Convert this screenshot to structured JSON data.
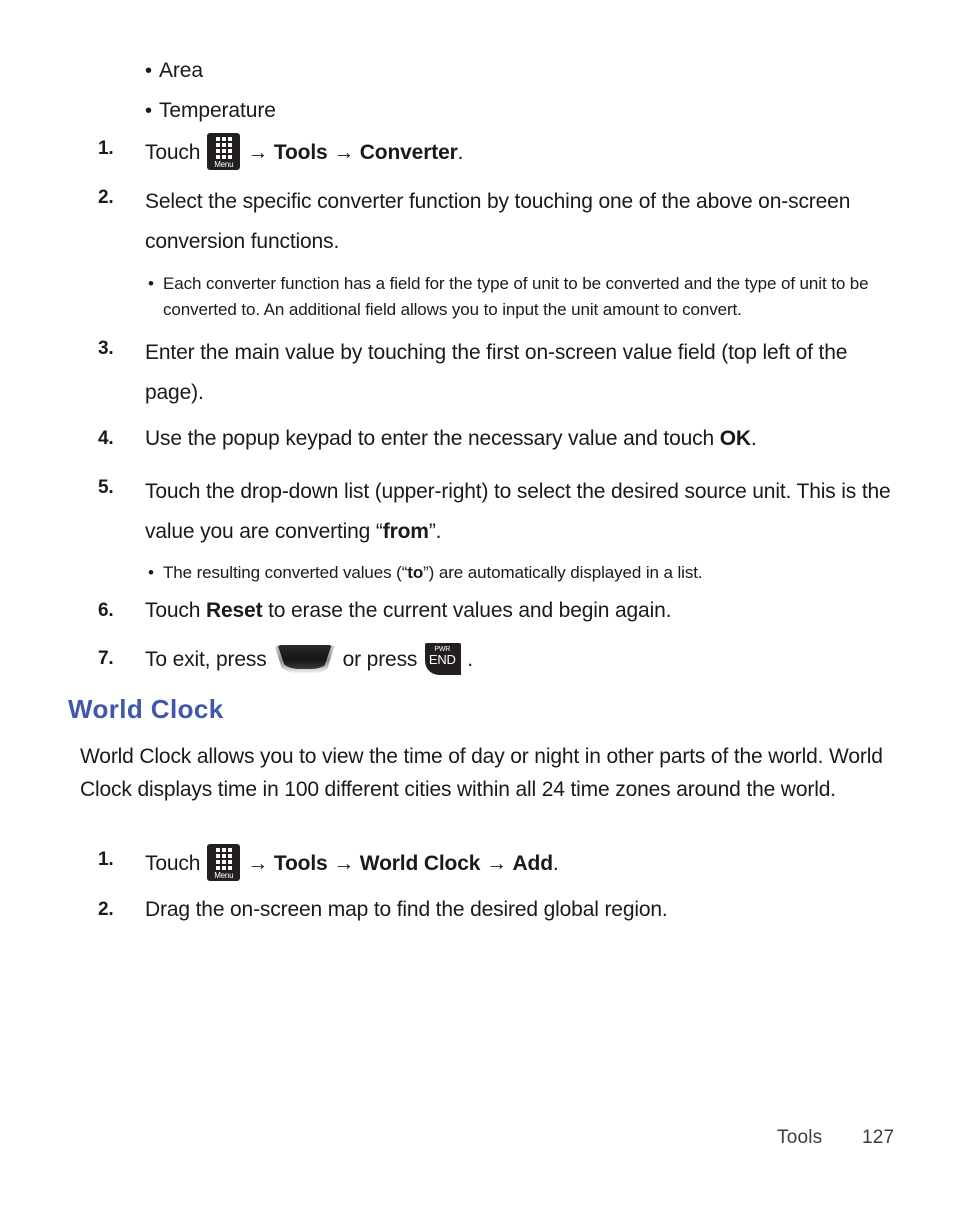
{
  "page": {
    "footer_section": "Tools",
    "footer_page_number": "127",
    "heading_color": "#4057ab",
    "text_color": "#1a1a1a"
  },
  "converter": {
    "bullets": [
      {
        "text": "Area"
      },
      {
        "text": "Temperature"
      }
    ],
    "steps": [
      {
        "num": "1.",
        "prefix": "Touch",
        "icon": "menu-key-icon",
        "arrow": "→",
        "path": [
          "Tools",
          "Converter"
        ],
        "suffix": "."
      },
      {
        "num": "2.",
        "text": "Select the specific converter function by touching one of the above on-screen conversion functions."
      },
      {
        "num": "3.",
        "text": "Enter the main value by touching the first on-screen value field (top left of the page)."
      },
      {
        "num": "4.",
        "text_before": "Use the popup keypad to enter the necessary value and touch ",
        "bold": "OK",
        "text_after": "."
      },
      {
        "num": "5.",
        "text_before": "Touch the drop-down list (upper-right) to select the desired source unit. This is the value you are converting “",
        "bold": "from",
        "text_after": "”."
      },
      {
        "num": "6.",
        "text_before": "Touch ",
        "bold": "Reset",
        "text_after": " to erase the current values and begin again."
      },
      {
        "num": "7.",
        "prefix": "To exit, press",
        "icon1": "back-key-icon",
        "middle": "or press",
        "icon2": "end-key-icon",
        "suffix": "."
      }
    ],
    "subbullets": [
      {
        "text": "Each converter function has a field for the type of unit to be converted and the type of unit to be converted to. An additional field allows you to input the unit amount to convert."
      },
      {
        "text_before": "The resulting converted values (“",
        "bold": "to",
        "text_after": "”) are automatically displayed in a list."
      }
    ]
  },
  "world_clock": {
    "heading": "World Clock",
    "paragraph": "World Clock allows you to view the time of day or night in other parts of the world. World Clock displays time in 100 different cities within all 24 time zones around the world.",
    "steps": [
      {
        "num": "1.",
        "prefix": "Touch",
        "icon": "menu-key-icon",
        "arrow": "→",
        "path": [
          "Tools",
          "World Clock",
          "Add"
        ],
        "suffix": "."
      },
      {
        "num": "2.",
        "text": "Drag the on-screen map to find the desired global region."
      }
    ]
  },
  "icons": {
    "menu_key_label": "Menu",
    "end_key_top_label": "PWR",
    "end_key_main_label": "END"
  }
}
